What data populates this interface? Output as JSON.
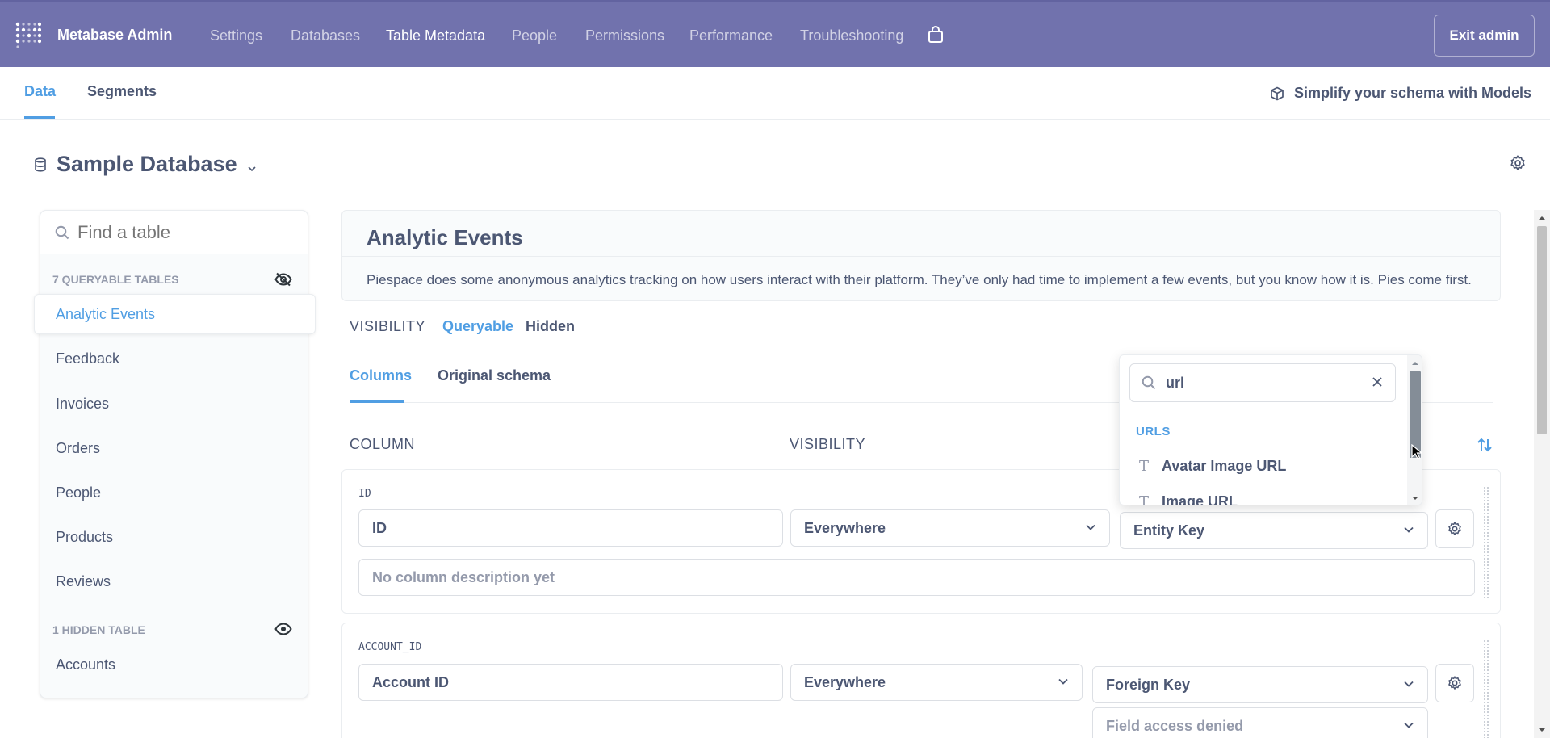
{
  "topbar": {
    "brand": "Metabase Admin",
    "nav": [
      "Settings",
      "Databases",
      "Table Metadata",
      "People",
      "Permissions",
      "Performance",
      "Troubleshooting"
    ],
    "active_nav": "Table Metadata",
    "exit_label": "Exit admin",
    "bg_color": "#7172ad"
  },
  "subtabs": {
    "data": "Data",
    "segments": "Segments",
    "models_link": "Simplify your schema with Models"
  },
  "database": {
    "name": "Sample Database"
  },
  "sidebar": {
    "search_placeholder": "Find a table",
    "queryable_heading": "7 QUERYABLE TABLES",
    "active_table": "Analytic Events",
    "tables": [
      "Feedback",
      "Invoices",
      "Orders",
      "People",
      "Products",
      "Reviews"
    ],
    "hidden_heading": "1 HIDDEN TABLE",
    "hidden_tables": [
      "Accounts"
    ]
  },
  "table": {
    "name": "Analytic Events",
    "description": "Piespace does some anonymous analytics tracking on how users interact with their platform. They’ve only had time to implement a few events, but you know how it is. Pies come first.",
    "visibility_label": "VISIBILITY",
    "visibility_options": [
      "Queryable",
      "Hidden"
    ],
    "tabs": [
      "Columns",
      "Original schema"
    ]
  },
  "columns_header": {
    "column": "COLUMN",
    "visibility": "VISIBILITY"
  },
  "fields": [
    {
      "code": "ID",
      "display_name": "ID",
      "visibility": "Everywhere",
      "semantic_type": "Entity Key",
      "description_placeholder": "No column description yet"
    },
    {
      "code": "ACCOUNT_ID",
      "display_name": "Account ID",
      "visibility": "Everywhere",
      "semantic_type": "Foreign Key",
      "target": "Field access denied"
    }
  ],
  "popover": {
    "search_value": "url",
    "group": "URLS",
    "items": [
      "Avatar Image URL",
      "Image URL"
    ]
  },
  "colors": {
    "accent": "#509ee3",
    "text": "#4c5773"
  }
}
